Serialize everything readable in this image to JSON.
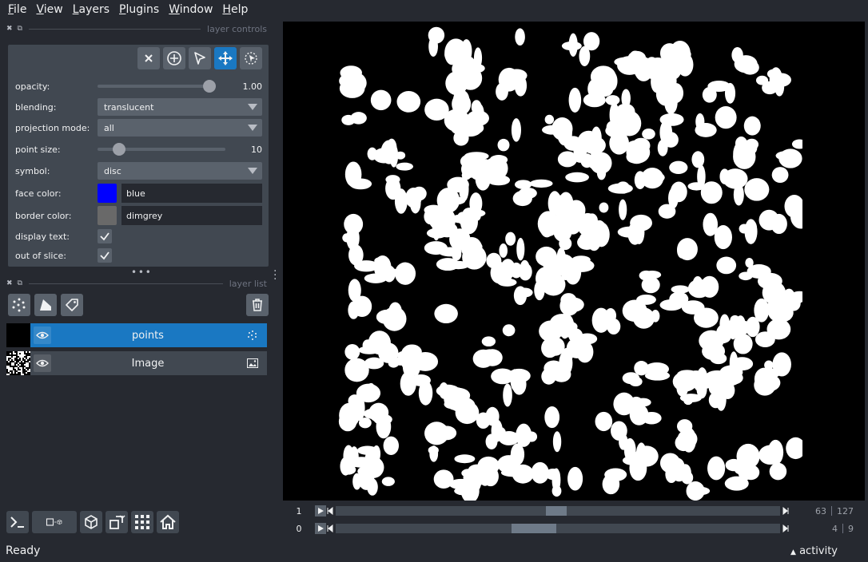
{
  "menu": [
    {
      "key": "F",
      "rest": "ile"
    },
    {
      "key": "V",
      "rest": "iew"
    },
    {
      "key": "L",
      "rest": "ayers"
    },
    {
      "key": "P",
      "rest": "lugins"
    },
    {
      "key": "W",
      "rest": "indow"
    },
    {
      "key": "H",
      "rest": "elp"
    }
  ],
  "layer_controls": {
    "title": "layer controls",
    "opacity": {
      "label": "opacity:",
      "value": "1.00",
      "level": 1.0
    },
    "blending": {
      "label": "blending:",
      "value": "translucent"
    },
    "projection_mode": {
      "label": "projection mode:",
      "value": "all"
    },
    "point_size": {
      "label": "point size:",
      "value": "10",
      "level": 0.13
    },
    "symbol": {
      "label": "symbol:",
      "value": "disc"
    },
    "face_color": {
      "label": "face color:",
      "value": "blue",
      "swatch": "#0000ff"
    },
    "border_color": {
      "label": "border color:",
      "value": "dimgrey",
      "swatch": "#696969"
    },
    "display_text": {
      "label": "display text:",
      "checked": true
    },
    "out_of_slice": {
      "label": "out of slice:",
      "checked": true
    }
  },
  "layer_list": {
    "title": "layer list",
    "layers": [
      {
        "name": "points",
        "selected": true,
        "type_icon": "points-icon"
      },
      {
        "name": "Image",
        "selected": false,
        "type_icon": "image-icon"
      }
    ]
  },
  "dims": [
    {
      "index": "1",
      "current": "63",
      "total": "127",
      "position": 0.496
    },
    {
      "index": "0",
      "current": "4",
      "total": "9",
      "position": 0.44
    }
  ],
  "status": {
    "text": "Ready",
    "activity": "activity"
  },
  "colors": {
    "accent": "#1a78c2",
    "panel": "#414851",
    "background": "#262930"
  }
}
